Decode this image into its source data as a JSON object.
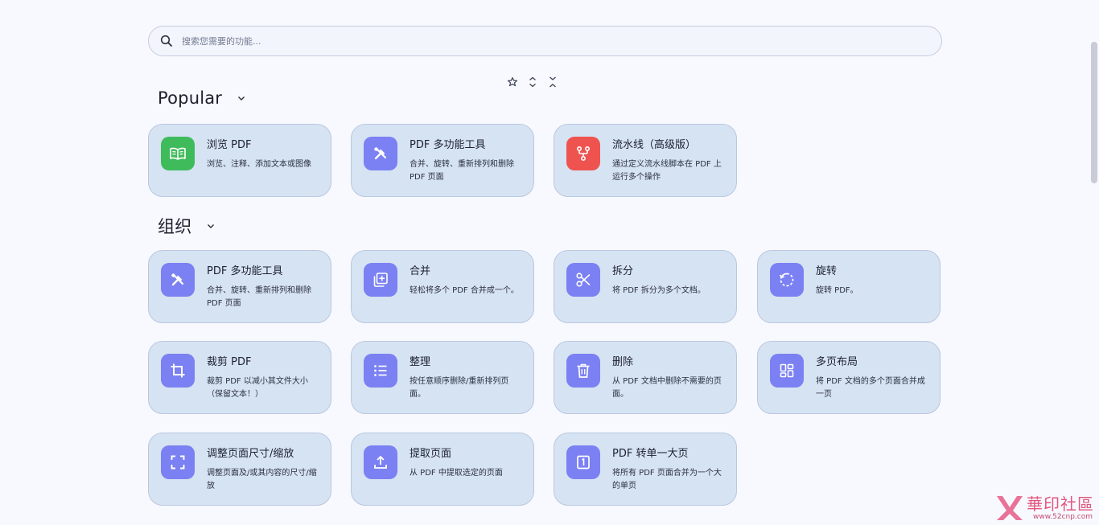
{
  "search": {
    "placeholder": "搜索您需要的功能..."
  },
  "view_controls": [
    {
      "icon": "star-outline-icon"
    },
    {
      "icon": "expand-all-icon"
    },
    {
      "icon": "collapse-all-icon"
    }
  ],
  "sections": {
    "popular": {
      "title": "Popular",
      "cards": [
        {
          "title": "浏览 PDF",
          "desc": "浏览、注释、添加文本或图像",
          "icon": "book-open-icon",
          "color": "#3fbb5c"
        },
        {
          "title": "PDF 多功能工具",
          "desc": "合并、旋转、重新排列和删除 PDF 页面",
          "icon": "tools-icon",
          "color": "#7b80f2"
        },
        {
          "title": "流水线（高级版）",
          "desc": "通过定义流水线脚本在 PDF 上运行多个操作",
          "icon": "pipeline-icon",
          "color": "#ef5350"
        }
      ]
    },
    "organize": {
      "title": "组织",
      "cards": [
        {
          "title": "PDF 多功能工具",
          "desc": "合并、旋转、重新排列和删除 PDF 页面",
          "icon": "tools-icon"
        },
        {
          "title": "合并",
          "desc": "轻松将多个 PDF 合并成一个。",
          "icon": "merge-icon"
        },
        {
          "title": "拆分",
          "desc": "将 PDF 拆分为多个文档。",
          "icon": "scissors-icon"
        },
        {
          "title": "旋转",
          "desc": "旋转 PDF。",
          "icon": "rotate-icon"
        },
        {
          "title": "裁剪 PDF",
          "desc": "裁剪 PDF 以减小其文件大小（保留文本！）",
          "icon": "crop-icon"
        },
        {
          "title": "整理",
          "desc": "按任意顺序删除/重新排列页面。",
          "icon": "list-icon"
        },
        {
          "title": "删除",
          "desc": "从 PDF 文档中删除不需要的页面。",
          "icon": "trash-icon"
        },
        {
          "title": "多页布局",
          "desc": "将 PDF 文档的多个页面合并成一页",
          "icon": "grid-layout-icon"
        },
        {
          "title": "调整页面尺寸/缩放",
          "desc": "调整页面及/或其内容的尺寸/缩放",
          "icon": "fullscreen-icon"
        },
        {
          "title": "提取页面",
          "desc": "从 PDF 中提取选定的页面",
          "icon": "upload-icon"
        },
        {
          "title": "PDF 转单一大页",
          "desc": "将所有 PDF 页面合并为一个大的单页",
          "icon": "single-page-icon"
        }
      ]
    }
  },
  "watermark": {
    "title": "華印社區",
    "url": "www.52cnp.com"
  }
}
